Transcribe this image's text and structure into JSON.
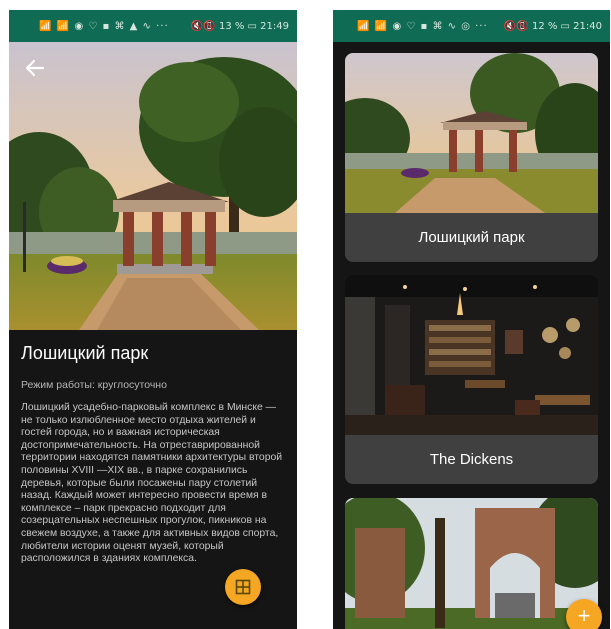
{
  "status_bar_left": {
    "left_icons": "📶 📶 ◉ ♡ ▪ ⌘ ▲ ∿ ···",
    "right": "🔇📵 13 % ▭ 21:49"
  },
  "status_bar_right": {
    "left_icons": "📶 📶 ◉ ♡ ▪ ⌘ ∿ ◎ ···",
    "right": "🔇📵 12 % ▭ 21:40"
  },
  "detail": {
    "title": "Лошицкий парк",
    "hours": "Режим работы: круглосуточно",
    "description": "Лошицкий усадебно-парковый комплекс в Минске — не только излюбленное место отдыха жителей и гостей города, но и важная историческая достопримечательность. На отреставрированной территории находятся памятники архитектуры второй половины XVIII —XIX вв., в парке сохранились деревья, которые были посажены пару столетий назад. Каждый может интересно провести время в комплексе – парк прекрасно подходит для созерцательных неспешных прогулок, пикников на свежем воздухе, а также для активных видов спорта, любители истории оценят музей, который расположился в зданиях комплекса."
  },
  "places": [
    {
      "name": "Лошицкий парк"
    },
    {
      "name": "The Dickens"
    },
    {
      "name": ""
    }
  ],
  "icons": {
    "back": "arrow-left-icon",
    "map": "map-grid-icon",
    "add": "plus-icon"
  },
  "colors": {
    "status_bar": "#0f6b53",
    "background": "#151515",
    "card": "#404040",
    "fab": "#f5a623",
    "text_primary": "#ffffff",
    "text_secondary": "#b5b5b5"
  }
}
